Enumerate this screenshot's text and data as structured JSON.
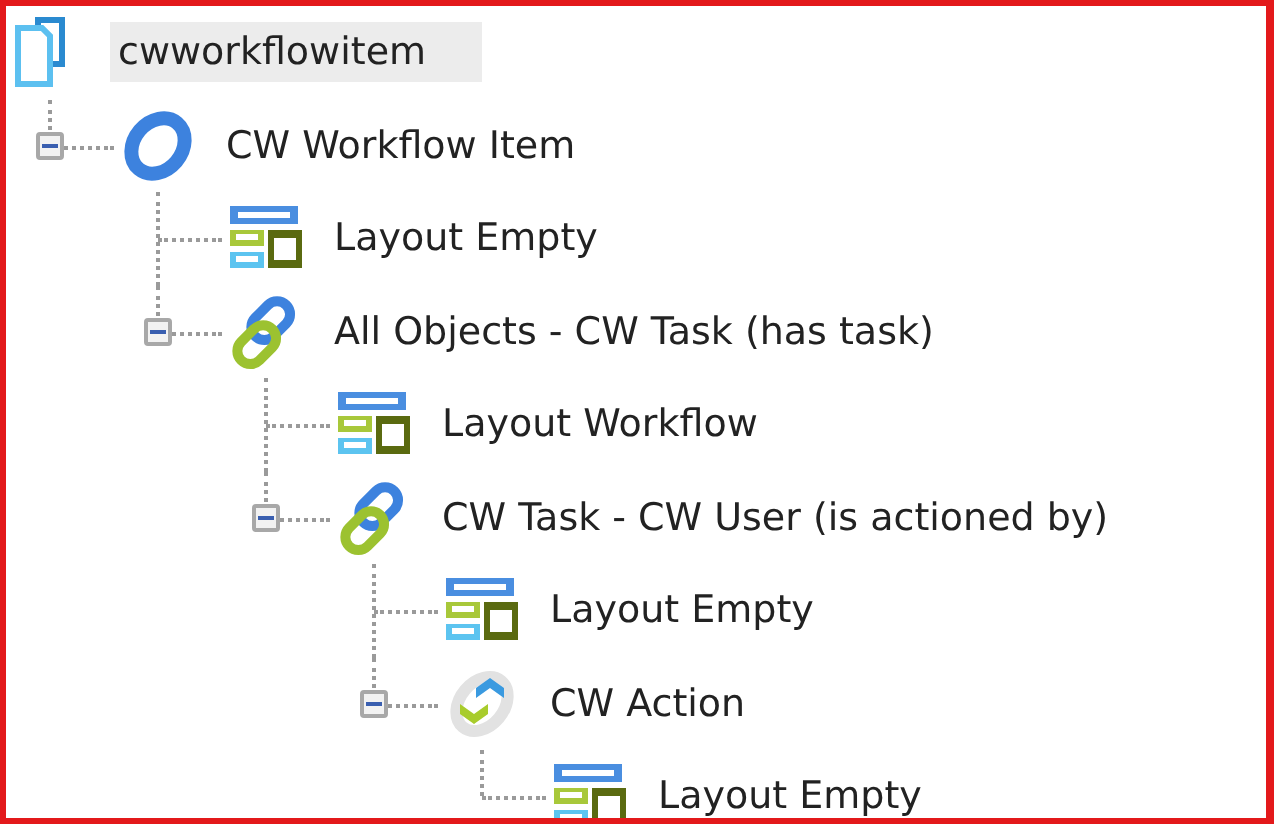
{
  "tree": {
    "kind": "document",
    "label": "cwworkflowitem",
    "selected": true,
    "children": [
      {
        "kind": "object",
        "label": "CW Workflow Item",
        "selected": false,
        "expanded": true,
        "children": [
          {
            "kind": "layout",
            "label": "Layout Empty",
            "selected": false
          },
          {
            "kind": "relation",
            "label": "All Objects - CW Task (has task)",
            "selected": false,
            "expanded": true,
            "children": [
              {
                "kind": "layout",
                "label": "Layout Workflow",
                "selected": false
              },
              {
                "kind": "relation",
                "label": "CW Task - CW User (is actioned by)",
                "selected": false,
                "expanded": true,
                "children": [
                  {
                    "kind": "layout",
                    "label": "Layout Empty",
                    "selected": false
                  },
                  {
                    "kind": "action",
                    "label": "CW Action",
                    "selected": false,
                    "expanded": true,
                    "children": [
                      {
                        "kind": "layout",
                        "label": "Layout Empty",
                        "selected": false
                      }
                    ]
                  }
                ]
              }
            ]
          }
        ]
      }
    ]
  }
}
